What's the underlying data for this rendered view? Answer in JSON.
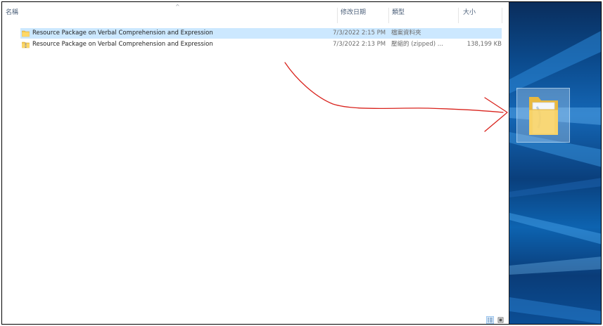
{
  "header": {
    "col_name": "名稱",
    "col_date": "修改日期",
    "col_type": "類型",
    "col_size": "大小",
    "sort_indicator": "^"
  },
  "files": [
    {
      "name": "Resource Package on Verbal Comprehension and Expression",
      "date": "7/3/2022 2:15 PM",
      "type": "檔案資料夾",
      "size": "",
      "icon": "folder-icon",
      "selected": true
    },
    {
      "name": "Resource Package on Verbal Comprehension and Expression",
      "date": "7/3/2022 2:13 PM",
      "type": "壓縮的 (zipped) ...",
      "size": "138,199 KB",
      "icon": "zip-folder-icon",
      "selected": false
    }
  ],
  "view_buttons": [
    "details-view-icon",
    "large-icons-view-icon"
  ],
  "desktop": {
    "item_icon": "folder-icon"
  },
  "colors": {
    "selection": "#cce8ff",
    "header_text": "#4c607a",
    "annotation_arrow": "#d9231d",
    "folder": "#f5c94e"
  }
}
